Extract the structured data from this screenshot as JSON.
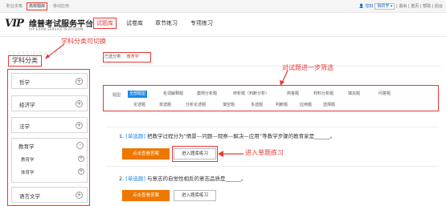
{
  "topbar": {
    "tabs": [
      "职业资格",
      "高校题库",
      "移动应用"
    ],
    "right_welcome": "您好",
    "user_select": "我的学",
    "links": [
      "退出",
      "首页",
      "帮助",
      "后台"
    ]
  },
  "header": {
    "logo_letters": "VIP",
    "platform_title": "维普考试服务平台",
    "platform_subtitle": "VIP EXAM SERVICE PLATFORM",
    "nav": [
      "试题库",
      "试卷库",
      "章节练习",
      "专项练习"
    ]
  },
  "annotations": {
    "switch_subject": "学科分类可切换",
    "filter_further": "对试题进一步筛选",
    "enter_single": "进入单题练习"
  },
  "sidebar": {
    "watermark": "CLASSIFICATION",
    "title": "学科分类",
    "categories": [
      {
        "label": "哲学",
        "toggle": "+"
      },
      {
        "label": "经济学",
        "toggle": "+"
      },
      {
        "label": "法学",
        "toggle": "+"
      },
      {
        "label": "教育学",
        "toggle": "-"
      },
      {
        "label": "语言文学",
        "toggle": "+"
      }
    ],
    "subcategories": [
      {
        "label": "教育学",
        "toggle": "+"
      },
      {
        "label": "体育学",
        "toggle": "+"
      }
    ]
  },
  "filter": {
    "selected_label": "已选分类:",
    "selected_value": "教育学",
    "type_label": "题型:",
    "types_row1": [
      "全部题型",
      "名词解释题",
      "案例分析题",
      "辨析题（判断分析）",
      "简答题",
      "材料分析题",
      "填充题",
      "问答题"
    ],
    "types_row2": [
      "论述题",
      "单选题",
      "分析论述题",
      "填空题",
      "多选题",
      "判断题",
      "应用题",
      "选择题"
    ]
  },
  "questions": [
    {
      "number": "1.",
      "type": "[单选题]",
      "text": "把教学过程分为“情景—问题—观察—解决—应用”等教学步骤的教育家是______。",
      "view_answer": "点击查看答案",
      "enter_practice": "进入题库练习"
    },
    {
      "number": "2.",
      "type": "[单选题]",
      "text": "与意志的自觉性相反的意志品质是______。",
      "view_answer": "点击查看答案",
      "enter_practice": "进入题库练习"
    }
  ],
  "colors": {
    "accent_red": "#e53935",
    "chip_blue": "#1e88e5",
    "button_orange": "#ee7700"
  }
}
